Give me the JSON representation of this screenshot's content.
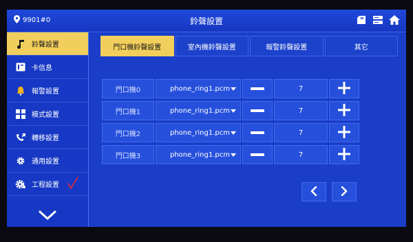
{
  "header": {
    "device_id": "9901#0",
    "title": "鈴聲設置",
    "icons": [
      "location-pin-icon",
      "sd-card-icon",
      "storage-icon",
      "home-icon"
    ]
  },
  "sidebar": {
    "items": [
      {
        "label": "鈴聲設置",
        "icon": "music-note-icon",
        "active": true
      },
      {
        "label": "卡信息",
        "icon": "id-card-icon",
        "active": false
      },
      {
        "label": "報警設置",
        "icon": "alarm-bell-icon",
        "active": false
      },
      {
        "label": "模式設置",
        "icon": "grid-icon",
        "active": false
      },
      {
        "label": "轉移設置",
        "icon": "call-transfer-icon",
        "active": false
      },
      {
        "label": "通用設置",
        "icon": "gear-icon",
        "active": false
      },
      {
        "label": "工程設置",
        "icon": "engineering-gear-icon",
        "active": false
      }
    ],
    "more_icon": "chevron-down-icon"
  },
  "tabs": [
    {
      "label": "門口機鈴聲設置",
      "active": true
    },
    {
      "label": "室內機鈴聲設置",
      "active": false
    },
    {
      "label": "報警鈴聲設置",
      "active": false
    },
    {
      "label": "其它",
      "active": false
    }
  ],
  "ring_rows": [
    {
      "name": "門口機0",
      "ringtone": "phone_ring1.pcm",
      "volume": "7"
    },
    {
      "name": "門口機1",
      "ringtone": "phone_ring1.pcm",
      "volume": "7"
    },
    {
      "name": "門口機2",
      "ringtone": "phone_ring1.pcm",
      "volume": "7"
    },
    {
      "name": "門口機3",
      "ringtone": "phone_ring1.pcm",
      "volume": "7"
    }
  ],
  "colors": {
    "background": "#1a3ec8",
    "active": "#f2cf5c",
    "cell": "#2650dc",
    "annotation": "#e8282c"
  }
}
